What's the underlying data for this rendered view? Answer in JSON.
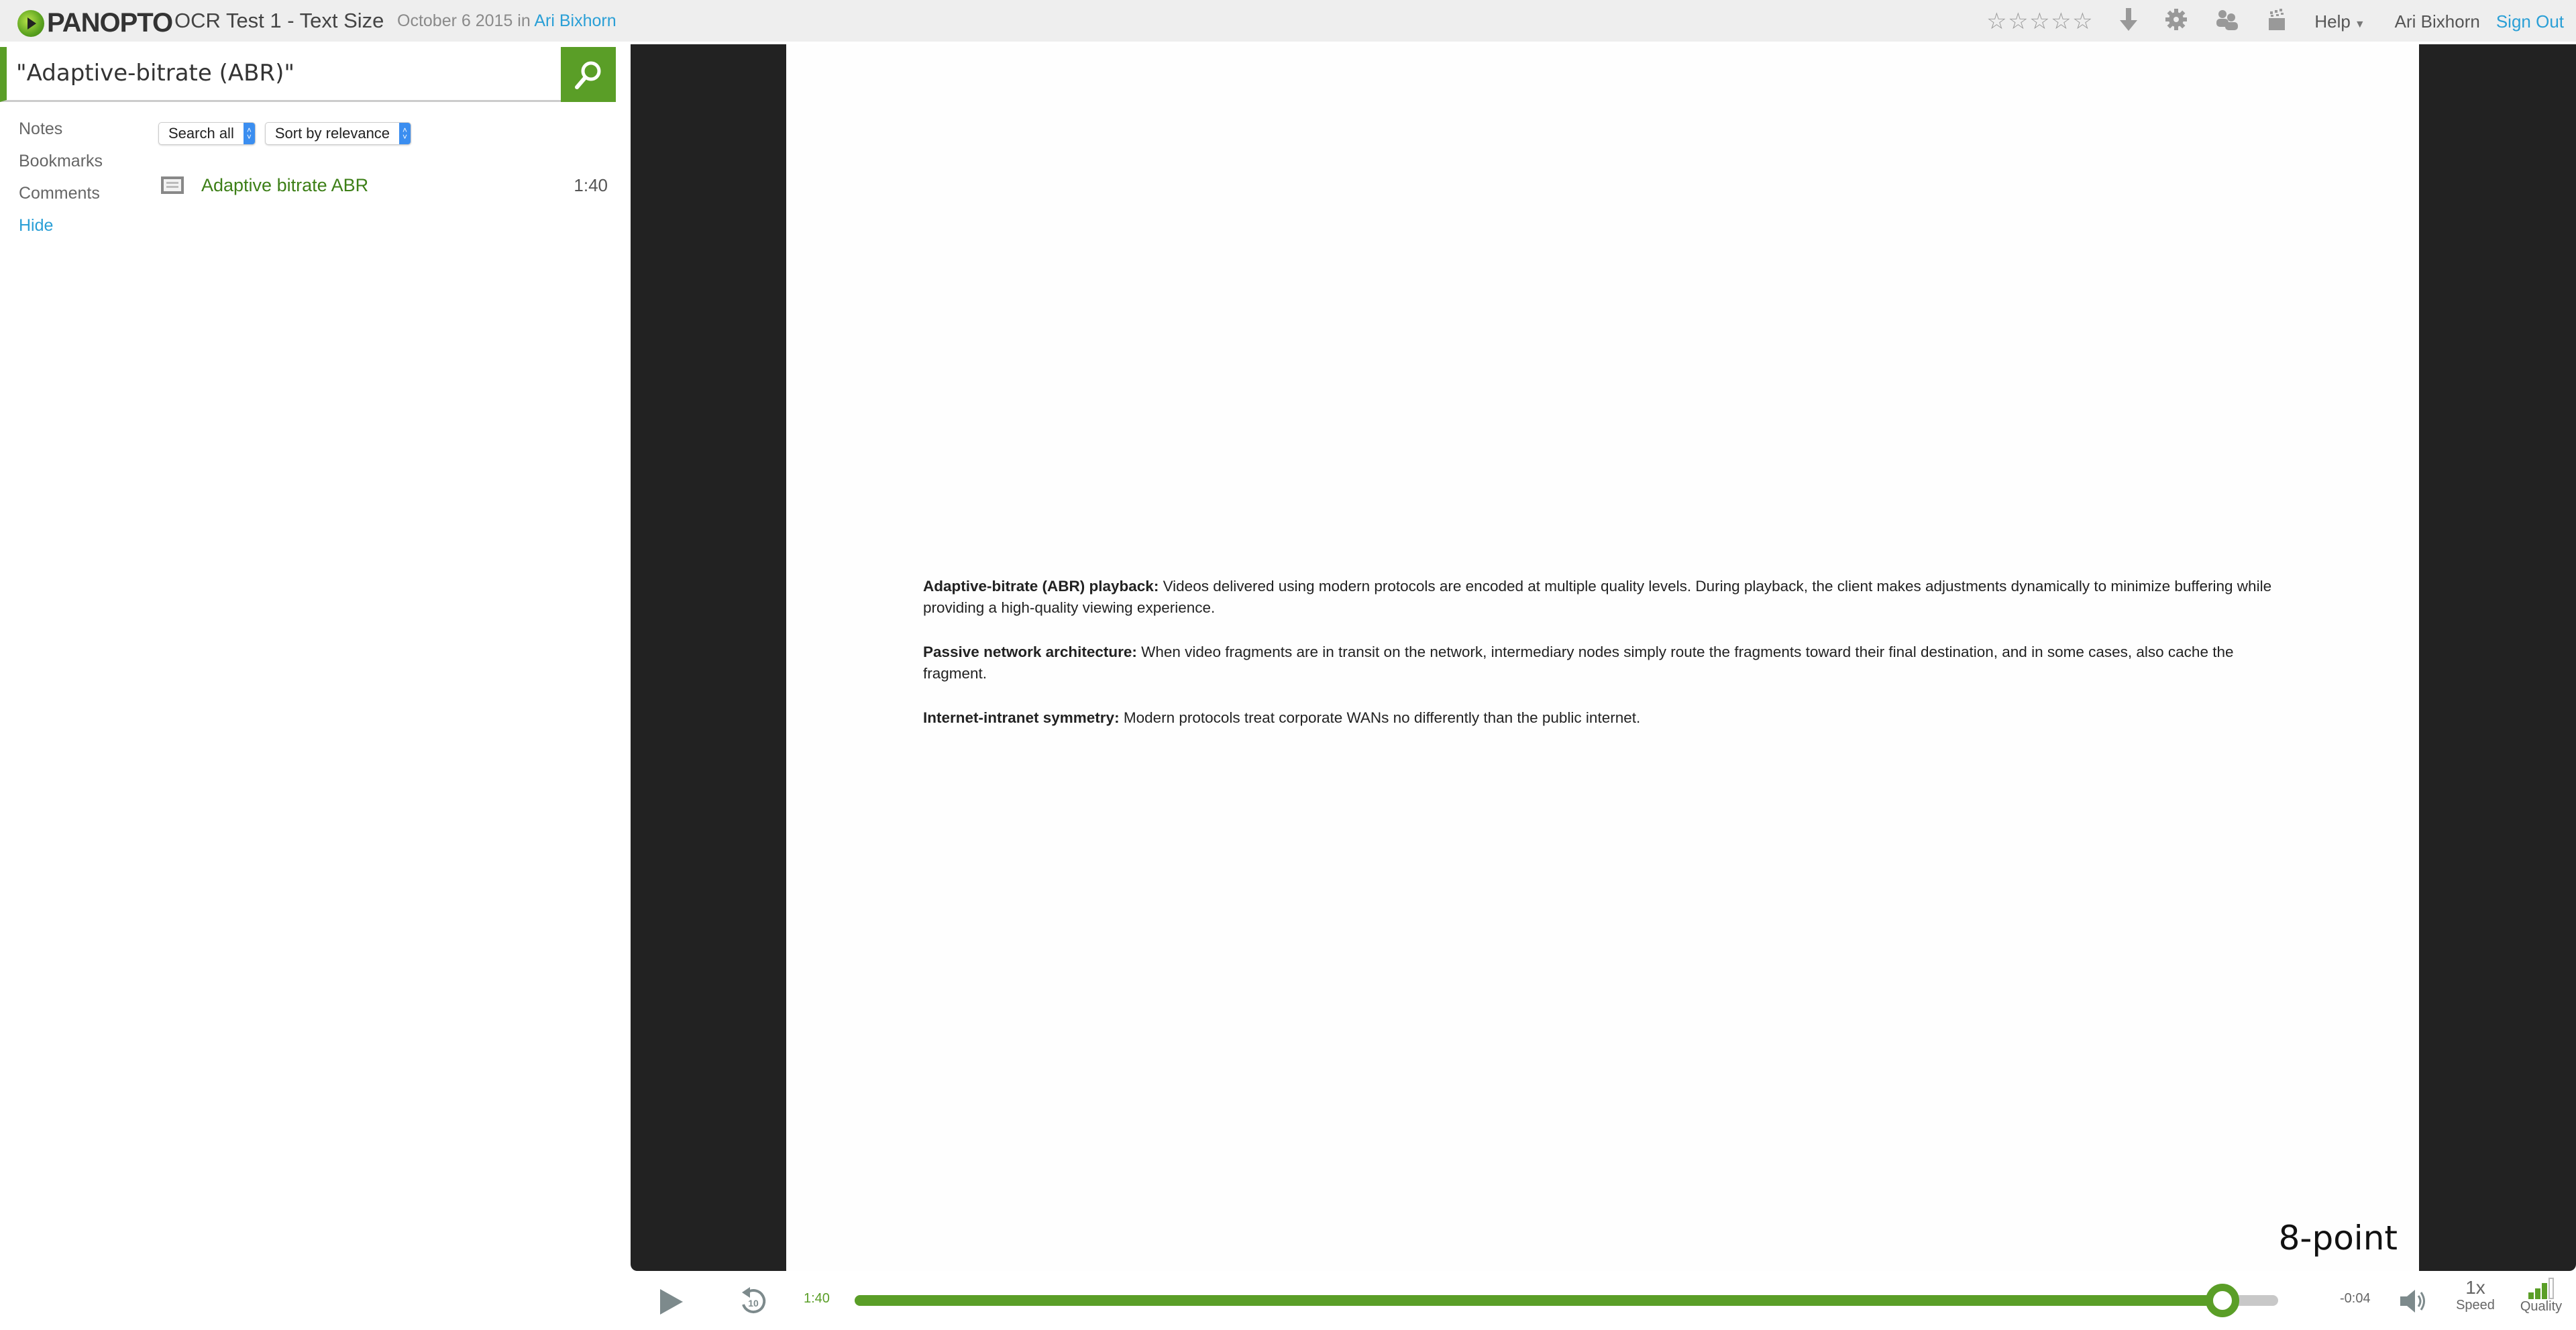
{
  "header": {
    "logo_text": "PANOPTO",
    "session_title": "OCR Test 1 - Text Size",
    "date": "October 6 2015",
    "in_label": "in",
    "author": "Ari Bixhorn",
    "rating": {
      "value": 0,
      "max": 5
    },
    "icons": [
      "download-icon",
      "gear-icon",
      "people-icon",
      "clapperboard-icon"
    ],
    "help_label": "Help",
    "user_name": "Ari Bixhorn",
    "sign_out_label": "Sign Out"
  },
  "sidebar": {
    "search": {
      "value": "\"Adaptive-bitrate (ABR)\"",
      "button_icon": "search-icon"
    },
    "nav": [
      {
        "label": "Notes"
      },
      {
        "label": "Bookmarks"
      },
      {
        "label": "Comments"
      }
    ],
    "hide_label": "Hide",
    "filters": {
      "scope": {
        "selected": "Search all"
      },
      "sort": {
        "selected": "Sort by relevance"
      }
    },
    "results": [
      {
        "icon": "slide-icon",
        "title": "Adaptive bitrate ABR",
        "time": "1:40"
      }
    ]
  },
  "slide": {
    "paragraphs": [
      {
        "term": "Adaptive-bitrate (ABR) playback:",
        "text": " Videos delivered using modern protocols are encoded at multiple quality levels. During playback, the client makes adjustments dynamically to minimize buffering while providing a high-quality viewing experience."
      },
      {
        "term": "Passive network architecture:",
        "text": " When video fragments are in transit on the network, intermediary nodes simply route the fragments toward their final destination, and in some cases, also cache the fragment."
      },
      {
        "term": "Internet-intranet symmetry:",
        "text": " Modern protocols treat corporate WANs no differently than the public internet."
      }
    ],
    "label": "8-point"
  },
  "player": {
    "current_time": "1:40",
    "remaining_time": "-0:04",
    "progress_percent": 96.1,
    "speed_value": "1x",
    "speed_label": "Speed",
    "quality_label": "Quality",
    "quality_level": 3,
    "quality_max": 4,
    "accent_color": "#5a9e27"
  }
}
